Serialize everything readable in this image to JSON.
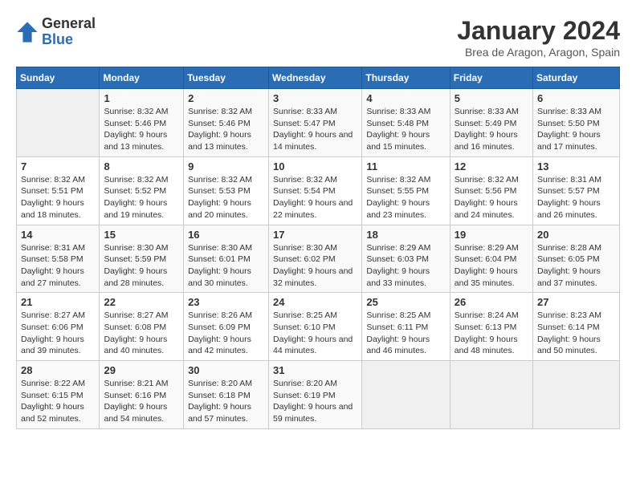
{
  "header": {
    "logo_general": "General",
    "logo_blue": "Blue",
    "month_title": "January 2024",
    "location": "Brea de Aragon, Aragon, Spain"
  },
  "calendar": {
    "weekdays": [
      "Sunday",
      "Monday",
      "Tuesday",
      "Wednesday",
      "Thursday",
      "Friday",
      "Saturday"
    ],
    "weeks": [
      [
        {
          "day": "",
          "sunrise": "",
          "sunset": "",
          "daylight": ""
        },
        {
          "day": "1",
          "sunrise": "Sunrise: 8:32 AM",
          "sunset": "Sunset: 5:46 PM",
          "daylight": "Daylight: 9 hours and 13 minutes."
        },
        {
          "day": "2",
          "sunrise": "Sunrise: 8:32 AM",
          "sunset": "Sunset: 5:46 PM",
          "daylight": "Daylight: 9 hours and 13 minutes."
        },
        {
          "day": "3",
          "sunrise": "Sunrise: 8:33 AM",
          "sunset": "Sunset: 5:47 PM",
          "daylight": "Daylight: 9 hours and 14 minutes."
        },
        {
          "day": "4",
          "sunrise": "Sunrise: 8:33 AM",
          "sunset": "Sunset: 5:48 PM",
          "daylight": "Daylight: 9 hours and 15 minutes."
        },
        {
          "day": "5",
          "sunrise": "Sunrise: 8:33 AM",
          "sunset": "Sunset: 5:49 PM",
          "daylight": "Daylight: 9 hours and 16 minutes."
        },
        {
          "day": "6",
          "sunrise": "Sunrise: 8:33 AM",
          "sunset": "Sunset: 5:50 PM",
          "daylight": "Daylight: 9 hours and 17 minutes."
        }
      ],
      [
        {
          "day": "7",
          "sunrise": "Sunrise: 8:32 AM",
          "sunset": "Sunset: 5:51 PM",
          "daylight": "Daylight: 9 hours and 18 minutes."
        },
        {
          "day": "8",
          "sunrise": "Sunrise: 8:32 AM",
          "sunset": "Sunset: 5:52 PM",
          "daylight": "Daylight: 9 hours and 19 minutes."
        },
        {
          "day": "9",
          "sunrise": "Sunrise: 8:32 AM",
          "sunset": "Sunset: 5:53 PM",
          "daylight": "Daylight: 9 hours and 20 minutes."
        },
        {
          "day": "10",
          "sunrise": "Sunrise: 8:32 AM",
          "sunset": "Sunset: 5:54 PM",
          "daylight": "Daylight: 9 hours and 22 minutes."
        },
        {
          "day": "11",
          "sunrise": "Sunrise: 8:32 AM",
          "sunset": "Sunset: 5:55 PM",
          "daylight": "Daylight: 9 hours and 23 minutes."
        },
        {
          "day": "12",
          "sunrise": "Sunrise: 8:32 AM",
          "sunset": "Sunset: 5:56 PM",
          "daylight": "Daylight: 9 hours and 24 minutes."
        },
        {
          "day": "13",
          "sunrise": "Sunrise: 8:31 AM",
          "sunset": "Sunset: 5:57 PM",
          "daylight": "Daylight: 9 hours and 26 minutes."
        }
      ],
      [
        {
          "day": "14",
          "sunrise": "Sunrise: 8:31 AM",
          "sunset": "Sunset: 5:58 PM",
          "daylight": "Daylight: 9 hours and 27 minutes."
        },
        {
          "day": "15",
          "sunrise": "Sunrise: 8:30 AM",
          "sunset": "Sunset: 5:59 PM",
          "daylight": "Daylight: 9 hours and 28 minutes."
        },
        {
          "day": "16",
          "sunrise": "Sunrise: 8:30 AM",
          "sunset": "Sunset: 6:01 PM",
          "daylight": "Daylight: 9 hours and 30 minutes."
        },
        {
          "day": "17",
          "sunrise": "Sunrise: 8:30 AM",
          "sunset": "Sunset: 6:02 PM",
          "daylight": "Daylight: 9 hours and 32 minutes."
        },
        {
          "day": "18",
          "sunrise": "Sunrise: 8:29 AM",
          "sunset": "Sunset: 6:03 PM",
          "daylight": "Daylight: 9 hours and 33 minutes."
        },
        {
          "day": "19",
          "sunrise": "Sunrise: 8:29 AM",
          "sunset": "Sunset: 6:04 PM",
          "daylight": "Daylight: 9 hours and 35 minutes."
        },
        {
          "day": "20",
          "sunrise": "Sunrise: 8:28 AM",
          "sunset": "Sunset: 6:05 PM",
          "daylight": "Daylight: 9 hours and 37 minutes."
        }
      ],
      [
        {
          "day": "21",
          "sunrise": "Sunrise: 8:27 AM",
          "sunset": "Sunset: 6:06 PM",
          "daylight": "Daylight: 9 hours and 39 minutes."
        },
        {
          "day": "22",
          "sunrise": "Sunrise: 8:27 AM",
          "sunset": "Sunset: 6:08 PM",
          "daylight": "Daylight: 9 hours and 40 minutes."
        },
        {
          "day": "23",
          "sunrise": "Sunrise: 8:26 AM",
          "sunset": "Sunset: 6:09 PM",
          "daylight": "Daylight: 9 hours and 42 minutes."
        },
        {
          "day": "24",
          "sunrise": "Sunrise: 8:25 AM",
          "sunset": "Sunset: 6:10 PM",
          "daylight": "Daylight: 9 hours and 44 minutes."
        },
        {
          "day": "25",
          "sunrise": "Sunrise: 8:25 AM",
          "sunset": "Sunset: 6:11 PM",
          "daylight": "Daylight: 9 hours and 46 minutes."
        },
        {
          "day": "26",
          "sunrise": "Sunrise: 8:24 AM",
          "sunset": "Sunset: 6:13 PM",
          "daylight": "Daylight: 9 hours and 48 minutes."
        },
        {
          "day": "27",
          "sunrise": "Sunrise: 8:23 AM",
          "sunset": "Sunset: 6:14 PM",
          "daylight": "Daylight: 9 hours and 50 minutes."
        }
      ],
      [
        {
          "day": "28",
          "sunrise": "Sunrise: 8:22 AM",
          "sunset": "Sunset: 6:15 PM",
          "daylight": "Daylight: 9 hours and 52 minutes."
        },
        {
          "day": "29",
          "sunrise": "Sunrise: 8:21 AM",
          "sunset": "Sunset: 6:16 PM",
          "daylight": "Daylight: 9 hours and 54 minutes."
        },
        {
          "day": "30",
          "sunrise": "Sunrise: 8:20 AM",
          "sunset": "Sunset: 6:18 PM",
          "daylight": "Daylight: 9 hours and 57 minutes."
        },
        {
          "day": "31",
          "sunrise": "Sunrise: 8:20 AM",
          "sunset": "Sunset: 6:19 PM",
          "daylight": "Daylight: 9 hours and 59 minutes."
        },
        {
          "day": "",
          "sunrise": "",
          "sunset": "",
          "daylight": ""
        },
        {
          "day": "",
          "sunrise": "",
          "sunset": "",
          "daylight": ""
        },
        {
          "day": "",
          "sunrise": "",
          "sunset": "",
          "daylight": ""
        }
      ]
    ]
  }
}
